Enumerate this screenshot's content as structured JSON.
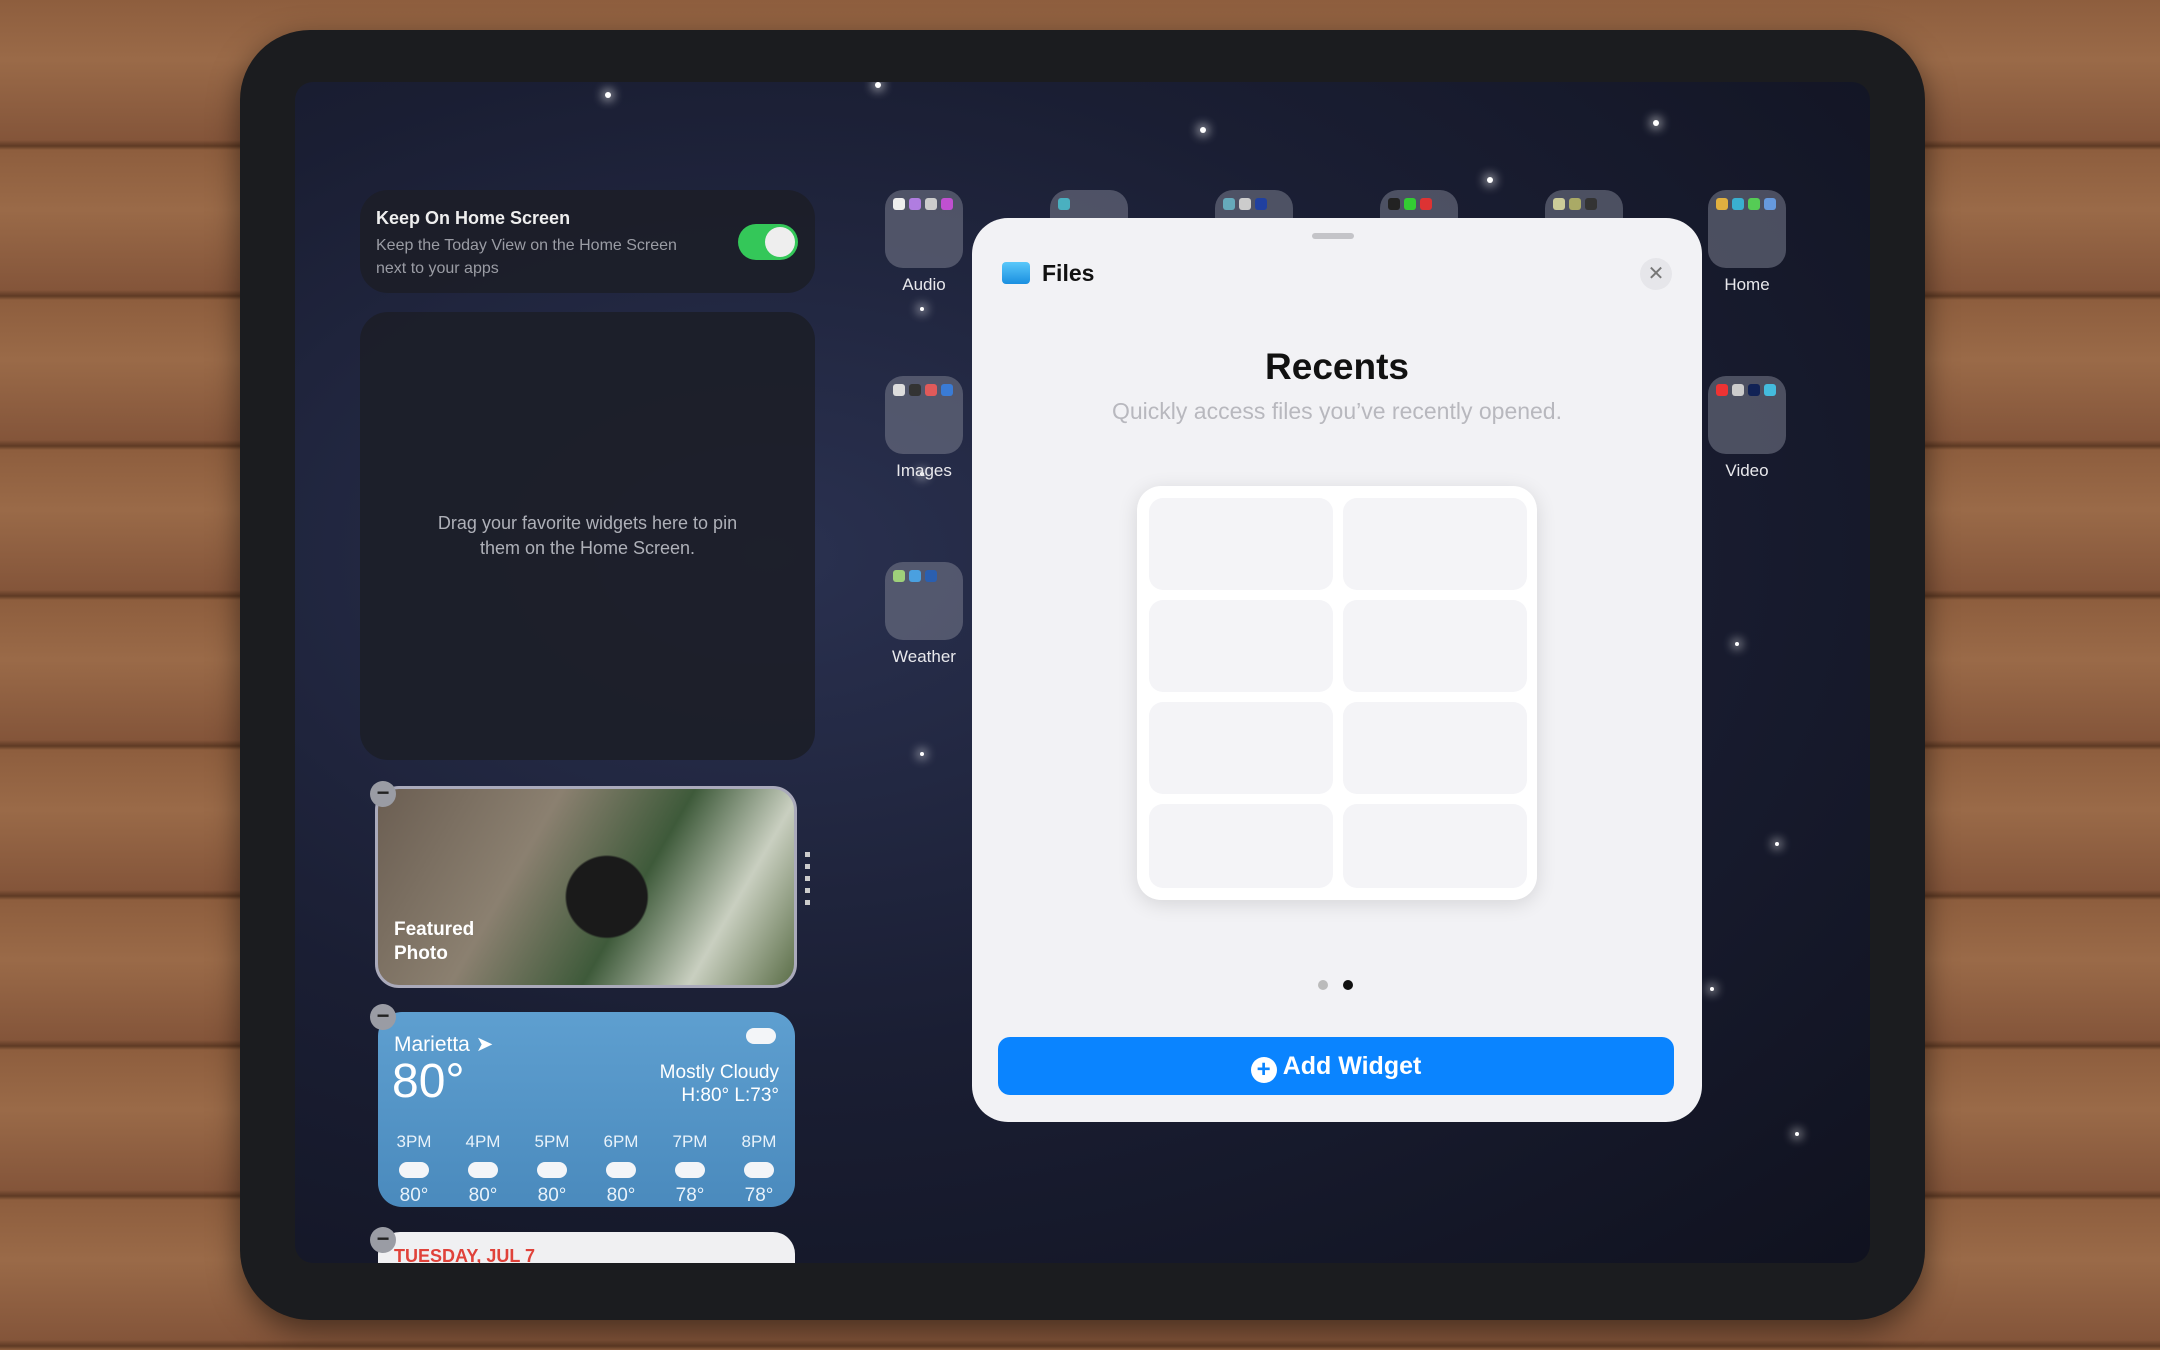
{
  "keep_card": {
    "title": "Keep On Home Screen",
    "subtitle_line1": "Keep the Today View on the Home Screen",
    "subtitle_line2": "next to your apps",
    "toggle_on": true
  },
  "drop_area": {
    "line1": "Drag your favorite widgets here to pin",
    "line2": "them on the Home Screen."
  },
  "photo_widget": {
    "label_line1": "Featured",
    "label_line2": "Photo"
  },
  "weather": {
    "city": "Marietta",
    "temp": "80°",
    "condition": "Mostly Cloudy",
    "hilo": "H:80° L:73°",
    "hours": [
      {
        "time": "3PM",
        "temp": "80°",
        "icon": "cloud-icon"
      },
      {
        "time": "4PM",
        "temp": "80°",
        "icon": "cloud-icon"
      },
      {
        "time": "5PM",
        "temp": "80°",
        "icon": "cloud-icon"
      },
      {
        "time": "6PM",
        "temp": "80°",
        "icon": "cloud-icon"
      },
      {
        "time": "7PM",
        "temp": "78°",
        "icon": "cloud-icon"
      },
      {
        "time": "8PM",
        "temp": "78°",
        "icon": "partly-sunny-icon"
      }
    ]
  },
  "calendar": {
    "date": "TUESDAY, JUL 7"
  },
  "folders": {
    "audio": "Audio",
    "images": "Images",
    "weather": "Weather",
    "home": "Home",
    "video": "Video"
  },
  "sheet": {
    "app": "Files",
    "title": "Recents",
    "subtitle": "Quickly access files you’ve recently opened.",
    "page_count": 2,
    "current_page": 2,
    "add_button": "Add Widget"
  },
  "colors": {
    "accent": "#0a84ff",
    "toggle": "#34c759",
    "weather": "#4f95c8"
  }
}
